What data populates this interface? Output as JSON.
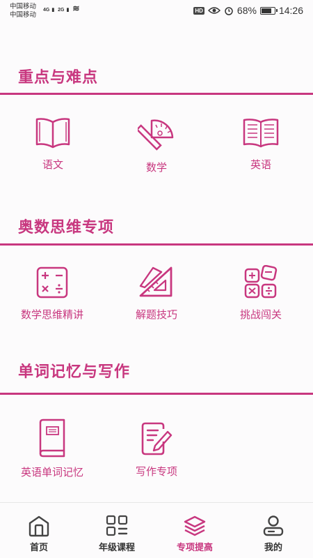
{
  "status_bar": {
    "carrier1": "中国移动",
    "carrier2": "中国移动",
    "net1": "4G",
    "net2": "2G",
    "hd": "HD",
    "battery": "68%",
    "battery_level": 0.68,
    "time": "14:26"
  },
  "sections": [
    {
      "title": "重点与难点",
      "items": [
        {
          "label": "语文",
          "icon": "open-book-icon"
        },
        {
          "label": "数学",
          "icon": "ruler-protractor-icon"
        },
        {
          "label": "英语",
          "icon": "reading-book-icon"
        }
      ]
    },
    {
      "title": "奥数思维专项",
      "items": [
        {
          "label": "数学思维精讲",
          "icon": "calculator-icon"
        },
        {
          "label": "解题技巧",
          "icon": "triangle-ruler-icon"
        },
        {
          "label": "挑战闯关",
          "icon": "math-operators-icon"
        }
      ]
    },
    {
      "title": "单词记忆与写作",
      "items": [
        {
          "label": "英语单词记忆",
          "icon": "closed-book-icon"
        },
        {
          "label": "写作专项",
          "icon": "note-pen-icon"
        }
      ]
    }
  ],
  "bottom_nav": [
    {
      "label": "首页",
      "icon": "home-icon",
      "active": false
    },
    {
      "label": "年级课程",
      "icon": "grid-icon",
      "active": false
    },
    {
      "label": "专项提高",
      "icon": "layers-icon",
      "active": true
    },
    {
      "label": "我的",
      "icon": "profile-icon",
      "active": false
    }
  ],
  "colors": {
    "accent": "#c8377f",
    "text": "#333333",
    "background": "#fcfbfc"
  }
}
